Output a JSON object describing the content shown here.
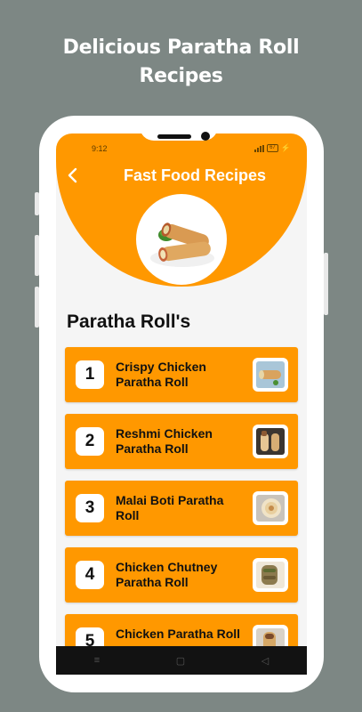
{
  "promo": {
    "line1": "Delicious Paratha Roll",
    "line2": "Recipes"
  },
  "status": {
    "time": "9:12",
    "battery": "67"
  },
  "header": {
    "title": "Fast Food Recipes",
    "back_icon": "chevron-left-icon"
  },
  "section": {
    "title": "Paratha Roll's"
  },
  "recipes": [
    {
      "number": "1",
      "name": "Crispy Chicken Paratha Roll"
    },
    {
      "number": "2",
      "name": "Reshmi Chicken Paratha Roll"
    },
    {
      "number": "3",
      "name": "Malai Boti Paratha Roll"
    },
    {
      "number": "4",
      "name": "Chicken Chutney Paratha Roll"
    },
    {
      "number": "5",
      "name": "Chicken Paratha Roll"
    }
  ],
  "nav": {
    "menu_icon": "≡",
    "home_icon": "▢",
    "back_icon": "◁"
  },
  "colors": {
    "accent": "#ff9800",
    "background": "#7d8784",
    "screen": "#f5f5f5"
  }
}
